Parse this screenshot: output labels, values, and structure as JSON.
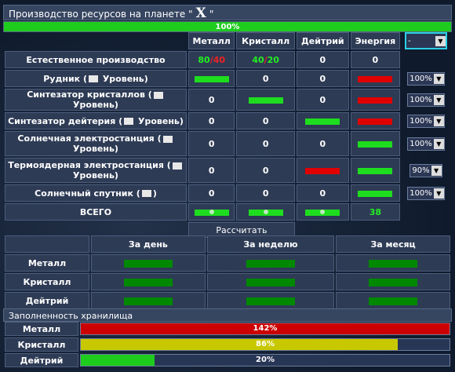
{
  "title": {
    "prefix": "Производство ресурсов на планете \"",
    "planet": "X",
    "suffix": "\""
  },
  "overall_percent": "100%",
  "columns": {
    "metal": "Металл",
    "crystal": "Кристалл",
    "deut": "Дейтрий",
    "energy": "Энергия"
  },
  "global_select": "-",
  "natural": {
    "label": "Естественное производство",
    "metal_a": "80",
    "metal_sep": "/",
    "metal_b": "40",
    "crystal_a": "40",
    "crystal_sep": "/",
    "crystal_b": "20",
    "deut": "0",
    "energy": "0"
  },
  "rows": [
    {
      "label_a": "Рудник (",
      "label_b": " Уровень)",
      "metal": "",
      "crystal": "0",
      "deut": "0",
      "energy": "",
      "select": "100%"
    },
    {
      "label_a": "Синтезатор кристаллов (",
      "label_b": " Уровень)",
      "metal": "0",
      "crystal": "",
      "deut": "0",
      "energy": "",
      "select": "100%"
    },
    {
      "label_a": "Синтезатор дейтерия (",
      "label_b": " Уровень)",
      "metal": "0",
      "crystal": "0",
      "deut": "",
      "energy": "",
      "select": "100%"
    },
    {
      "label_a": "Солнечная электростанция (",
      "label_b": "Уровень)",
      "metal": "0",
      "crystal": "0",
      "deut": "0",
      "energy": "",
      "select": "100%"
    },
    {
      "label_a": "Термоядерная электростанция (",
      "label_b": "Уровень)",
      "metal": "0",
      "crystal": "0",
      "deut": "",
      "energy": "",
      "select": "90%"
    },
    {
      "label_a": "Солнечный спутник (",
      "label_b": ")",
      "metal": "0",
      "crystal": "0",
      "deut": "0",
      "energy": "",
      "select": "100%"
    }
  ],
  "total": {
    "label": "ВСЕГО",
    "energy": "38"
  },
  "calc_button": "Рассчитать",
  "period": {
    "headers": {
      "day": "За день",
      "week": "За неделю",
      "month": "За месяц"
    },
    "rows": [
      "Металл",
      "Кристалл",
      "Дейтрий"
    ]
  },
  "storage": {
    "title": "Заполненность хранилища",
    "rows": [
      {
        "label": "Металл",
        "percent_text": "142%",
        "fill": 1.0,
        "color": "#cc0000"
      },
      {
        "label": "Кристалл",
        "percent_text": "86%",
        "fill": 0.86,
        "color": "#c8c800"
      },
      {
        "label": "Дейтрий",
        "percent_text": "20%",
        "fill": 0.2,
        "color": "#1ecc1e"
      }
    ]
  },
  "colors": {
    "green": "#1edd1e",
    "red": "#e00000",
    "darkgreen": "#008800",
    "accent": "#2ad0e6"
  }
}
